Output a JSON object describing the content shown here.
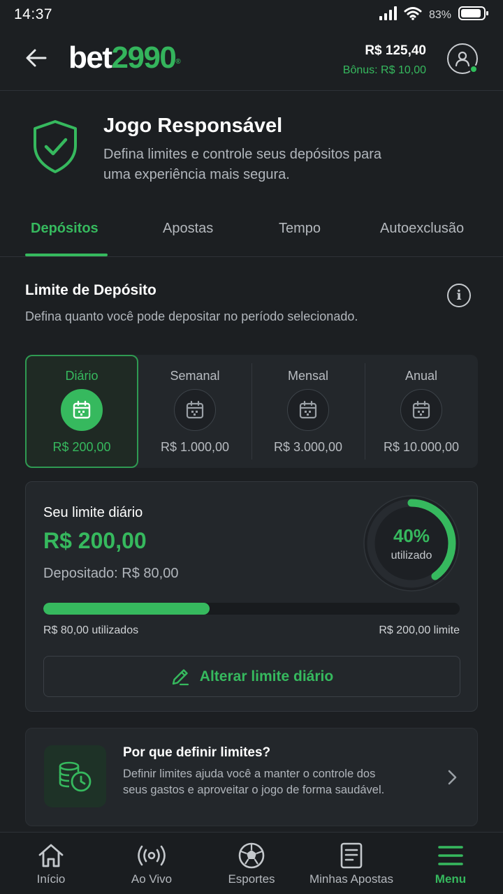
{
  "status_bar": {
    "time": "14:37",
    "battery_pct": "83%"
  },
  "header": {
    "logo_white": "bet",
    "logo_green": "2990",
    "balance": "R$ 125,40",
    "bonus": "Bônus: R$ 10,00"
  },
  "intro": {
    "title": "Jogo Responsável",
    "description": "Defina limites e controle seus depósitos para uma experiência mais segura."
  },
  "tabs": [
    {
      "label": "Depósitos",
      "active": true
    },
    {
      "label": "Apostas",
      "active": false
    },
    {
      "label": "Tempo",
      "active": false
    },
    {
      "label": "Autoexclusão",
      "active": false
    }
  ],
  "section": {
    "title": "Limite de Depósito",
    "description": "Defina quanto você pode depositar no período selecionado."
  },
  "periods": [
    {
      "label": "Diário",
      "amount": "R$ 200,00",
      "active": true
    },
    {
      "label": "Semanal",
      "amount": "R$ 1.000,00",
      "active": false
    },
    {
      "label": "Mensal",
      "amount": "R$ 3.000,00",
      "active": false
    },
    {
      "label": "Anual",
      "amount": "R$ 10.000,00",
      "active": false
    }
  ],
  "limit_card": {
    "label": "Seu limite diário",
    "amount": "R$ 200,00",
    "deposited": "Depositado: R$ 80,00",
    "percent_text": "40%",
    "percent_value": 0.4,
    "percent_sub": "utilizado",
    "used_text": "R$ 80,00 utilizados",
    "limit_text": "R$ 200,00 limite",
    "edit_button": "Alterar limite diário"
  },
  "why_card": {
    "title": "Por que definir limites?",
    "description": "Definir limites ajuda você a manter o controle dos seus gastos e aproveitar o jogo de forma saudável."
  },
  "bottom_nav": [
    {
      "label": "Início",
      "icon": "home-icon",
      "active": false
    },
    {
      "label": "Ao Vivo",
      "icon": "live-icon",
      "active": false
    },
    {
      "label": "Esportes",
      "icon": "soccer-ball-icon",
      "active": false
    },
    {
      "label": "Minhas Apostas",
      "icon": "bet-slip-icon",
      "active": false
    },
    {
      "label": "Menu",
      "icon": "menu-icon",
      "active": true
    }
  ],
  "colors": {
    "accent": "#36b95e",
    "background": "#1c1f22",
    "card": "#23272b"
  }
}
